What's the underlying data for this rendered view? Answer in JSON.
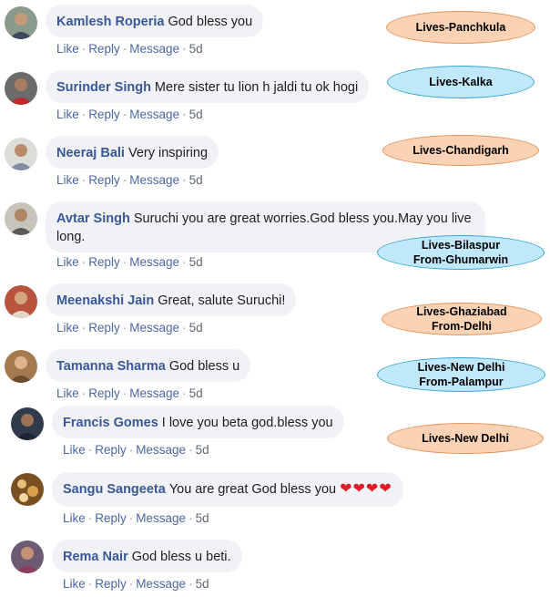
{
  "actions": {
    "like": "Like",
    "reply": "Reply",
    "message": "Message",
    "time": "5d",
    "dot": "·"
  },
  "comments": [
    {
      "author": "Kamlesh Roperia",
      "text": "God bless you",
      "label": "Lives-Panchkula",
      "label_color": "orange"
    },
    {
      "author": "Surinder Singh",
      "text": "Mere sister tu lion h jaldi tu ok hogi",
      "label": "Lives-Kalka",
      "label_color": "blue"
    },
    {
      "author": "Neeraj Bali",
      "text": "Very inspiring",
      "label": "Lives-Chandigarh",
      "label_color": "orange"
    },
    {
      "author": "Avtar Singh",
      "text": "Suruchi you are great worries.God bless you.May you live long.",
      "label": "Lives-Bilaspur",
      "label2": "From-Ghumarwin",
      "label_color": "blue"
    },
    {
      "author": "Meenakshi Jain",
      "text": "Great, salute Suruchi!",
      "label": "Lives-Ghaziabad",
      "label2": "From-Delhi",
      "label_color": "orange"
    },
    {
      "author": "Tamanna Sharma",
      "text": "God bless u",
      "label": "Lives-New Delhi",
      "label2": "From-Palampur",
      "label_color": "blue"
    },
    {
      "author": "Francis Gomes",
      "text": "I love you beta god.bless you",
      "label": "Lives-New Delhi",
      "label_color": "orange"
    },
    {
      "author": "Sangu Sangeeta",
      "text": "You are great God bless you",
      "emoji": "❤❤❤❤"
    },
    {
      "author": "Rema Nair",
      "text": "God bless u beti."
    }
  ],
  "colors": {
    "author": "#385898",
    "orange_fill": "#fbd3b4",
    "blue_fill": "#bfe9fb",
    "bubble": "#f0f2f5",
    "heart": "#e11d2a"
  }
}
